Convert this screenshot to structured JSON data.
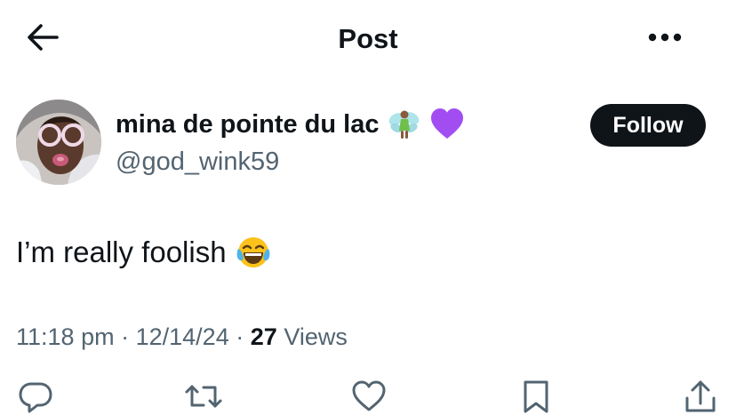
{
  "header": {
    "title": "Post",
    "back_icon": "arrow-left-icon",
    "more_icon": "more-horizontal-icon"
  },
  "author": {
    "display_name": "mina de pointe du lac",
    "display_name_emojis": [
      "fairy-emoji",
      "purple-heart-emoji"
    ],
    "handle": "@god_wink59",
    "avatar": "profile-photo"
  },
  "follow_button": {
    "label": "Follow"
  },
  "post": {
    "text": "I’m really foolish",
    "emoji": "face-with-tears-of-joy-emoji"
  },
  "meta": {
    "time": "11:18 pm",
    "separator": "·",
    "date": "12/14/24",
    "views_count": "27",
    "views_label": "Views"
  },
  "actions": [
    "reply-icon",
    "repost-icon",
    "like-icon",
    "bookmark-icon",
    "share-icon"
  ],
  "colors": {
    "text_primary": "#0f1419",
    "text_secondary": "#536471",
    "follow_bg": "#0f1419",
    "follow_text": "#ffffff",
    "purple_heart": "#a24df2"
  }
}
